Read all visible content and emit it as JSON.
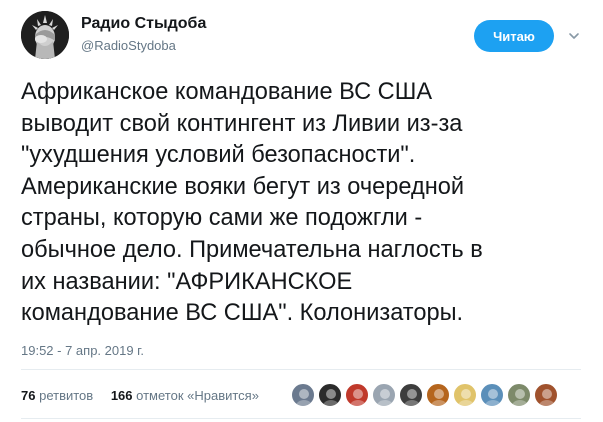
{
  "author": {
    "display_name": "Радио Стыдоба",
    "handle": "@RadioStydoba",
    "avatar_icon": "statue-of-liberty-facepalm-avatar"
  },
  "actions": {
    "follow_label": "Читаю",
    "menu_icon": "chevron-down-icon"
  },
  "tweet": {
    "lines": [
      "Африканское командование ВС США",
      "выводит свой контингент из Ливии из-за",
      "\"ухудшения условий безопасности\".",
      "Американские вояки бегут из очередной",
      "страны, которую сами же подожгли -",
      "обычное дело. Примечательна наглость в",
      "их названии: \"АФРИКАНСКОЕ",
      "командование ВС США\". Колонизаторы."
    ],
    "timestamp": "19:52 - 7 апр. 2019 г."
  },
  "stats": {
    "retweets_count": "76",
    "retweets_label": "ретвитов",
    "likes_count": "166",
    "likes_label": "отметок «Нравится»"
  },
  "likers": [
    {
      "icon": "liker-avatar-1",
      "color": "#6b7a8f"
    },
    {
      "icon": "liker-avatar-2",
      "color": "#2b2b2b"
    },
    {
      "icon": "liker-avatar-3",
      "color": "#c0392b"
    },
    {
      "icon": "liker-avatar-4",
      "color": "#9aa5b1"
    },
    {
      "icon": "liker-avatar-5",
      "color": "#3d3d3d"
    },
    {
      "icon": "liker-avatar-6",
      "color": "#b5651d"
    },
    {
      "icon": "liker-avatar-7",
      "color": "#e0c36a"
    },
    {
      "icon": "liker-avatar-8",
      "color": "#5b8fb9"
    },
    {
      "icon": "liker-avatar-9",
      "color": "#7d8a6a"
    },
    {
      "icon": "liker-avatar-10",
      "color": "#a0522d"
    }
  ],
  "colors": {
    "accent": "#1da1f2",
    "text_primary": "#14171a",
    "text_secondary": "#657786",
    "divider": "#e6ecf0"
  }
}
